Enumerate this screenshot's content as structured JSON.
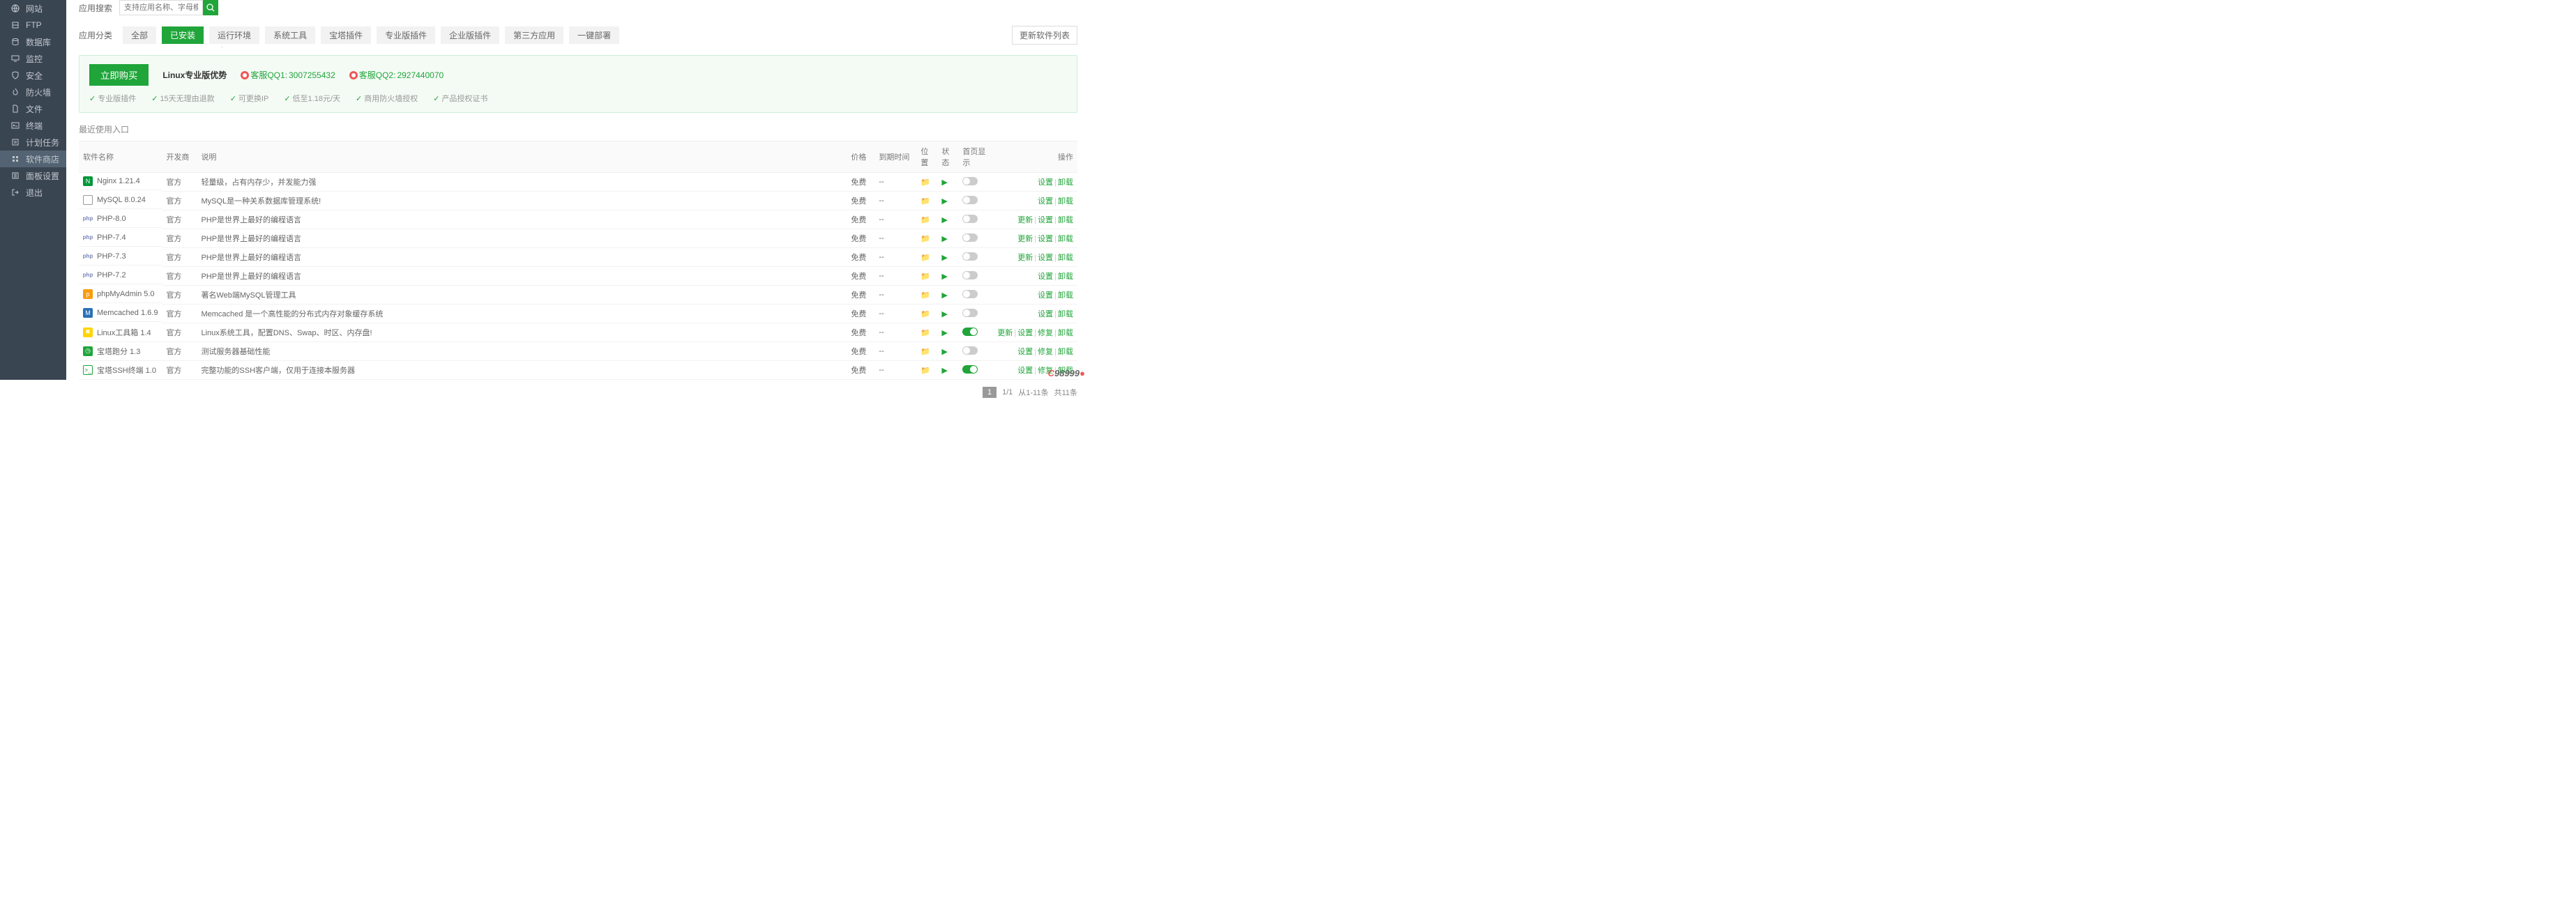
{
  "sidebar": [
    {
      "icon": "globe-icon",
      "label": "网站"
    },
    {
      "icon": "ftp-icon",
      "label": "FTP"
    },
    {
      "icon": "database-icon",
      "label": "数据库"
    },
    {
      "icon": "monitor-icon",
      "label": "监控"
    },
    {
      "icon": "shield-icon",
      "label": "安全"
    },
    {
      "icon": "fire-icon",
      "label": "防火墙"
    },
    {
      "icon": "file-icon",
      "label": "文件"
    },
    {
      "icon": "terminal-icon",
      "label": "终端"
    },
    {
      "icon": "task-icon",
      "label": "计划任务"
    },
    {
      "icon": "store-icon",
      "label": "软件商店",
      "active": true
    },
    {
      "icon": "settings-icon",
      "label": "面板设置"
    },
    {
      "icon": "exit-icon",
      "label": "退出"
    }
  ],
  "search": {
    "label": "应用搜索",
    "placeholder": "支持应用名称、字母模糊搜索"
  },
  "tabs": {
    "label": "应用分类",
    "items": [
      "全部",
      "已安装",
      "运行环境",
      "系统工具",
      "宝塔插件",
      "专业版插件",
      "企业版插件",
      "第三方应用",
      "一键部署"
    ],
    "active_index": 1,
    "update_btn": "更新软件列表"
  },
  "banner": {
    "buy": "立即购买",
    "title": "Linux专业版优势",
    "kf1_label": "客服QQ1:",
    "kf1_num": "3007255432",
    "kf2_label": "客服QQ2:",
    "kf2_num": "2927440070",
    "features": [
      "专业版插件",
      "15天无理由退款",
      "可更换IP",
      "低至1.18元/天",
      "商用防火墙授权",
      "产品授权证书"
    ]
  },
  "section_title": "最近使用入口",
  "columns": [
    "软件名称",
    "开发商",
    "说明",
    "价格",
    "到期时间",
    "位置",
    "状态",
    "首页显示",
    "操作"
  ],
  "rows": [
    {
      "icon": "ic-nginx",
      "iconText": "N",
      "name": "Nginx 1.21.4",
      "dev": "官方",
      "desc": "轻量级，占有内存少，并发能力强",
      "price": "免费",
      "expire": "--",
      "toggle": false,
      "actions": [
        "设置",
        "卸载"
      ]
    },
    {
      "icon": "ic-mysql",
      "iconText": "",
      "name": "MySQL 8.0.24",
      "dev": "官方",
      "desc": "MySQL是一种关系数据库管理系统!",
      "price": "免费",
      "expire": "--",
      "toggle": false,
      "actions": [
        "设置",
        "卸载"
      ]
    },
    {
      "icon": "ic-php",
      "iconText": "php",
      "name": "PHP-8.0",
      "dev": "官方",
      "desc": "PHP是世界上最好的编程语言",
      "price": "免费",
      "expire": "--",
      "toggle": false,
      "actions": [
        "更新",
        "设置",
        "卸载"
      ]
    },
    {
      "icon": "ic-php",
      "iconText": "php",
      "name": "PHP-7.4",
      "dev": "官方",
      "desc": "PHP是世界上最好的编程语言",
      "price": "免费",
      "expire": "--",
      "toggle": false,
      "actions": [
        "更新",
        "设置",
        "卸载"
      ]
    },
    {
      "icon": "ic-php",
      "iconText": "php",
      "name": "PHP-7.3",
      "dev": "官方",
      "desc": "PHP是世界上最好的编程语言",
      "price": "免费",
      "expire": "--",
      "toggle": false,
      "actions": [
        "更新",
        "设置",
        "卸载"
      ]
    },
    {
      "icon": "ic-php",
      "iconText": "php",
      "name": "PHP-7.2",
      "dev": "官方",
      "desc": "PHP是世界上最好的编程语言",
      "price": "免费",
      "expire": "--",
      "toggle": false,
      "actions": [
        "设置",
        "卸载"
      ]
    },
    {
      "icon": "ic-pma",
      "iconText": "p",
      "name": "phpMyAdmin 5.0",
      "dev": "官方",
      "desc": "著名Web端MySQL管理工具",
      "price": "免费",
      "expire": "--",
      "toggle": false,
      "actions": [
        "设置",
        "卸载"
      ]
    },
    {
      "icon": "ic-mc",
      "iconText": "M",
      "name": "Memcached 1.6.9",
      "dev": "官方",
      "desc": "Memcached 是一个高性能的分布式内存对象缓存系统",
      "price": "免费",
      "expire": "--",
      "toggle": false,
      "actions": [
        "设置",
        "卸载"
      ]
    },
    {
      "icon": "ic-lt",
      "iconText": "✖",
      "name": "Linux工具箱 1.4",
      "dev": "官方",
      "desc": "Linux系统工具，配置DNS、Swap、时区、内存盘!",
      "price": "免费",
      "expire": "--",
      "toggle": true,
      "actions": [
        "更新",
        "设置",
        "修复",
        "卸载"
      ]
    },
    {
      "icon": "ic-bt",
      "iconText": "◷",
      "name": "宝塔跑分 1.3",
      "dev": "官方",
      "desc": "测试服务器基础性能",
      "price": "免费",
      "expire": "--",
      "toggle": false,
      "actions": [
        "设置",
        "修复",
        "卸载"
      ]
    },
    {
      "icon": "ic-ssh",
      "iconText": ">_",
      "name": "宝塔SSH终端 1.0",
      "dev": "官方",
      "desc": "完整功能的SSH客户端，仅用于连接本服务器",
      "price": "免费",
      "expire": "--",
      "toggle": true,
      "actions": [
        "设置",
        "修复",
        "卸载"
      ]
    }
  ],
  "pager": {
    "page": "1",
    "pages": "1/1",
    "range": "从1-11条",
    "total": "共11条"
  },
  "watermark_num": "98999"
}
